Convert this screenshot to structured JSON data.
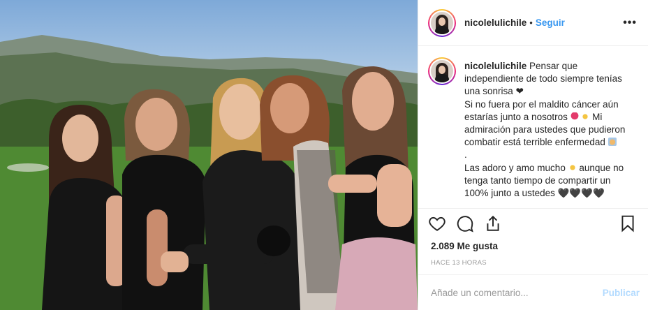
{
  "post": {
    "username": "nicolelulichile",
    "follow_label": "Seguir",
    "more_label": "•••",
    "caption": {
      "username": "nicolelulichile",
      "line1": "Pensar que independiente de todo siempre tenías una sonrisa",
      "heart1": "❤",
      "line2": "Si no fuera por el maldito cáncer aún estarías junto a nosotros",
      "line3": "Mi admiración para ustedes que pudieron combatir está terrible enfermedad",
      "line4": ".",
      "line5": "Las adoro y amo mucho",
      "line6": "aunque no tenga tanto tiempo de compartir un 100% junto a ustedes",
      "hearts_end": "🖤🖤🖤🖤"
    },
    "likes": "2.089 Me gusta",
    "time": "HACE 13 HORAS",
    "comment_placeholder": "Añade un comentario...",
    "publish_label": "Publicar"
  },
  "icons": {
    "like": "heart-outline-icon",
    "comment": "comment-bubble-icon",
    "share": "share-upload-icon",
    "save": "bookmark-icon",
    "more": "more-dots-icon"
  },
  "colors": {
    "accent": "#3897f0",
    "publish_disabled": "#b3dbff",
    "text": "#262626",
    "muted": "#999999",
    "divider": "#efefef"
  }
}
